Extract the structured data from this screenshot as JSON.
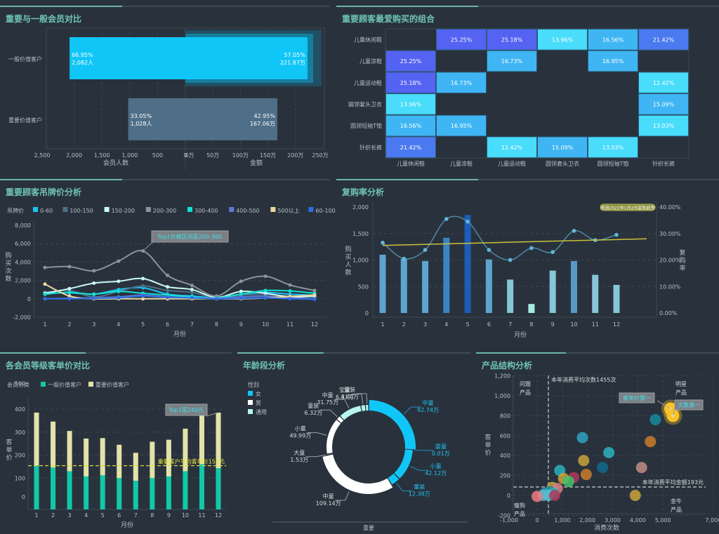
{
  "panels": {
    "p1": {
      "title": "重要与一般会员对比"
    },
    "p2": {
      "title": "重要顾客最爱购买的组合"
    },
    "p3": {
      "title": "重要顾客吊牌价分析"
    },
    "p4": {
      "title": "复购率分析"
    },
    "p5": {
      "title": "各会员等级客单价对比"
    },
    "p6": {
      "title": "年龄段分析"
    },
    "p7": {
      "title": "产品结构分析"
    }
  },
  "colors": {
    "title": "#6fc3b3",
    "bg": "#29323c",
    "accent_cyan": "#10c6f7",
    "steel": "#4f6e87",
    "teal": "#12c8a9",
    "khaki": "#e2e3a8"
  },
  "chart_data": [
    {
      "id": "member_compare",
      "type": "bar",
      "orientation": "horizontal-butterfly",
      "categories": [
        "一般价值客户",
        "重要价值客户"
      ],
      "left": {
        "xlabel": "会员人数",
        "ticks": [
          "2,500",
          "2,000",
          "1,500",
          "1,000",
          "500",
          "0"
        ],
        "xlim": [
          0,
          2500
        ],
        "values": [
          2082,
          1028
        ],
        "pct": [
          "66.95%",
          "33.05%"
        ],
        "labels": [
          "2,082人",
          "1,028人"
        ]
      },
      "right": {
        "xlabel": "金额",
        "ticks": [
          "0万",
          "50万",
          "100万",
          "150万",
          "200万",
          "250万"
        ],
        "xlim": [
          0,
          250
        ],
        "values": [
          221.87,
          167.06
        ],
        "pct": [
          "57.05%",
          "42.95%"
        ],
        "labels": [
          "221.87万",
          "167.06万"
        ]
      },
      "highlight": "一般价值客户"
    },
    {
      "id": "combo_heatmap",
      "type": "heatmap",
      "rows": [
        "儿童休闲鞋",
        "儿童凉鞋",
        "儿童运动鞋",
        "圆领套头卫衣",
        "圆领短袖T恤",
        "针织长裤"
      ],
      "cols": [
        "儿童休闲鞋",
        "儿童凉鞋",
        "儿童运动鞋",
        "圆领套头卫衣",
        "圆领短袖T恤",
        "针织长裤"
      ],
      "values": [
        [
          null,
          25.25,
          25.18,
          13.96,
          16.56,
          21.42
        ],
        [
          25.25,
          null,
          16.73,
          null,
          16.95,
          null
        ],
        [
          25.18,
          16.73,
          null,
          null,
          null,
          12.42
        ],
        [
          13.96,
          null,
          null,
          null,
          null,
          15.09
        ],
        [
          16.56,
          16.95,
          null,
          null,
          null,
          13.03
        ],
        [
          21.42,
          null,
          12.42,
          15.09,
          13.03,
          null
        ]
      ],
      "unit": "%"
    },
    {
      "id": "tag_price",
      "type": "line",
      "legend_title": "吊牌价",
      "x": [
        1,
        2,
        3,
        4,
        5,
        6,
        7,
        8,
        9,
        10,
        11,
        12
      ],
      "xlabel": "月份",
      "ylabel": "购买次数",
      "yticks": [
        "8,000",
        "6,000",
        "4,000",
        "2,000",
        "0",
        "-2,000"
      ],
      "ylim": [
        -2000,
        8000
      ],
      "annotation": {
        "text": "Top1价格区间是200-300",
        "x": 5
      },
      "series": [
        {
          "name": "0-60",
          "color": "#1ec3f4",
          "values": [
            600,
            650,
            500,
            1000,
            1200,
            500,
            300,
            100,
            500,
            700,
            500,
            400
          ]
        },
        {
          "name": "100-150",
          "color": "#4f6e87",
          "values": [
            700,
            900,
            200,
            800,
            1400,
            900,
            700,
            100,
            400,
            500,
            300,
            200
          ]
        },
        {
          "name": "150-200",
          "color": "#c9fbf6",
          "values": [
            600,
            1100,
            1700,
            1900,
            2200,
            1300,
            1000,
            150,
            800,
            600,
            200,
            300
          ]
        },
        {
          "name": "200-300",
          "color": "#8e9399",
          "values": [
            3400,
            3500,
            3050,
            4100,
            5200,
            2550,
            1450,
            300,
            1900,
            2450,
            1500,
            900
          ]
        },
        {
          "name": "300-400",
          "color": "#12e0d4",
          "values": [
            500,
            700,
            500,
            800,
            600,
            400,
            200,
            100,
            500,
            900,
            850,
            600
          ]
        },
        {
          "name": "400-500",
          "color": "#5c7ad6",
          "values": [
            0,
            50,
            100,
            200,
            400,
            200,
            100,
            50,
            200,
            300,
            100,
            0
          ]
        },
        {
          "name": "500以上",
          "color": "#ecd79c",
          "values": [
            1600,
            300,
            0,
            0,
            0,
            0,
            0,
            0,
            0,
            100,
            250,
            400
          ]
        },
        {
          "name": "60-100",
          "color": "#2f6be4",
          "values": [
            0,
            0,
            50,
            100,
            300,
            150,
            100,
            0,
            50,
            100,
            0,
            -50
          ]
        }
      ]
    },
    {
      "id": "repurchase",
      "type": "bar",
      "x": [
        1,
        2,
        3,
        4,
        5,
        6,
        7,
        8,
        9,
        10,
        11,
        12
      ],
      "xlabel": "月份",
      "ylabel": "购买人数",
      "y2label": "复购率",
      "yticks": [
        "2,000",
        "1,500",
        "1,000",
        "500",
        "0"
      ],
      "ylim": [
        0,
        2000
      ],
      "y2ticks": [
        "40.00%",
        "30.00%",
        "20.00%",
        "10.00%",
        "0.00%"
      ],
      "y2lim": [
        0,
        40
      ],
      "bars": [
        1100,
        1020,
        980,
        1420,
        1850,
        1010,
        630,
        170,
        800,
        980,
        720,
        530
      ],
      "rate": [
        26.5,
        20.5,
        23.8,
        35.5,
        34.5,
        23.8,
        20.0,
        24.5,
        23.0,
        31.0,
        27.5,
        29.5
      ],
      "trend": [
        25.5,
        28.0
      ],
      "badge": "预测2022年1月2月复购趋势"
    },
    {
      "id": "unit_price",
      "type": "bar",
      "stacked": true,
      "legend_title": "会员分类",
      "x": [
        1,
        2,
        3,
        4,
        5,
        6,
        7,
        8,
        9,
        10,
        11,
        12
      ],
      "xlabel": "月份",
      "ylabel": "客单价",
      "yticks": [
        "500",
        "400",
        "300",
        "200",
        "100",
        "0"
      ],
      "ylim": [
        -20,
        500
      ],
      "series": [
        {
          "name": "一般价值客户",
          "color": "#12c8a9",
          "values": [
            155,
            146,
            130,
            107,
            112,
            100,
            88,
            100,
            107,
            130,
            160,
            143
          ]
        },
        {
          "name": "重要价值客户",
          "color": "#e2e3a8",
          "values": [
            230,
            200,
            175,
            165,
            162,
            145,
            122,
            158,
            160,
            185,
            226,
            242
          ]
        }
      ],
      "avg_line": {
        "value": 154,
        "text": "重要客户平均客单价154元"
      },
      "annotation": {
        "text": "Top1是240元",
        "x": 12
      }
    },
    {
      "id": "age_donut",
      "type": "pie",
      "legend_title": "性别",
      "legend": [
        {
          "name": "女",
          "color": "#10c6f7"
        },
        {
          "name": "男",
          "color": "#ffffff"
        },
        {
          "name": "通用",
          "color": "#b6f6f1"
        }
      ],
      "slices": [
        {
          "group": "女",
          "label": "中童",
          "value": 92.74,
          "text": "92.74万"
        },
        {
          "group": "女",
          "label": "婴童",
          "value": 0.01,
          "text": "0.01万"
        },
        {
          "group": "女",
          "label": "小童",
          "value": 42.12,
          "text": "42.12万"
        },
        {
          "group": "女",
          "label": "童装",
          "value": 12.38,
          "text": "12.38万"
        },
        {
          "group": "男",
          "label": "中童",
          "value": 109.14,
          "text": "109.14万"
        },
        {
          "group": "男",
          "label": "大童",
          "value": 1.53,
          "text": "1.53万"
        },
        {
          "group": "男",
          "label": "小童",
          "value": 49.99,
          "text": "49.99万"
        },
        {
          "group": "男",
          "label": "童装",
          "value": 6.32,
          "text": "6.32万"
        },
        {
          "group": "通用",
          "label": "中童",
          "value": 31.75,
          "text": "31.75万"
        },
        {
          "group": "通用",
          "label": "宝宝",
          "value": 6.31,
          "text": "6.31万"
        },
        {
          "group": "通用",
          "label": "童装",
          "value": 4.4,
          "text": "4.40万"
        }
      ],
      "xlabel": "重要"
    },
    {
      "id": "product_structure",
      "type": "scatter",
      "xlabel": "消费次数",
      "ylabel": "客单价",
      "xticks": [
        "-1,000",
        "0",
        "1,000",
        "2,000",
        "3,000",
        "4,000",
        "5,000",
        "7,000"
      ],
      "xlim": [
        -1000,
        7000
      ],
      "yticks": [
        "1,200",
        "1,000",
        "800",
        "600",
        "400",
        "200",
        "0",
        "-200"
      ],
      "ylim": [
        -200,
        1200
      ],
      "vline": {
        "value": 1455,
        "text": "本年消费平均次数1455次"
      },
      "hline": {
        "value": 193,
        "text": "本年消费平均金额193元"
      },
      "quadrants": [
        "问题产品",
        "明星产品",
        "瘦狗产品",
        "金牛产品"
      ],
      "callouts": [
        {
          "text": "客单价第一"
        },
        {
          "text": "次数第一"
        }
      ],
      "points": [
        {
          "x": 5300,
          "y": 870,
          "c": "#f8c22a",
          "hl": true
        },
        {
          "x": 5400,
          "y": 800,
          "c": "#f8c22a",
          "hl": true
        },
        {
          "x": 4700,
          "y": 760,
          "c": "#17899f"
        },
        {
          "x": 4500,
          "y": 540,
          "c": "#c97c2a"
        },
        {
          "x": 1800,
          "y": 580,
          "c": "#2fa2c2"
        },
        {
          "x": 2850,
          "y": 430,
          "c": "#2ab2bd"
        },
        {
          "x": 1850,
          "y": 350,
          "c": "#c9a33a"
        },
        {
          "x": 2600,
          "y": 280,
          "c": "#0f6a8e"
        },
        {
          "x": 4150,
          "y": 280,
          "c": "#c08c84"
        },
        {
          "x": 900,
          "y": 250,
          "c": "#2ab2bd"
        },
        {
          "x": 1950,
          "y": 210,
          "c": "#c97c2a"
        },
        {
          "x": 1450,
          "y": 180,
          "c": "#b0375a"
        },
        {
          "x": 1050,
          "y": 170,
          "c": "#c9a33a"
        },
        {
          "x": 1250,
          "y": 140,
          "c": "#3ec46b"
        },
        {
          "x": 3900,
          "y": 0,
          "c": "#c9a33a"
        },
        {
          "x": 600,
          "y": 80,
          "c": "#c9a33a"
        },
        {
          "x": 800,
          "y": 70,
          "c": "#d47d86"
        },
        {
          "x": 500,
          "y": 40,
          "c": "#17899f"
        },
        {
          "x": 300,
          "y": 20,
          "c": "#2fa2c2"
        },
        {
          "x": 650,
          "y": 20,
          "c": "#2ab2bd"
        },
        {
          "x": 450,
          "y": 0,
          "c": "#52c6d9"
        },
        {
          "x": 700,
          "y": 0,
          "c": "#b0375a"
        },
        {
          "x": 250,
          "y": 0,
          "c": "#5bb8c9"
        },
        {
          "x": 0,
          "y": -10,
          "c": "#f07b85"
        }
      ]
    }
  ]
}
